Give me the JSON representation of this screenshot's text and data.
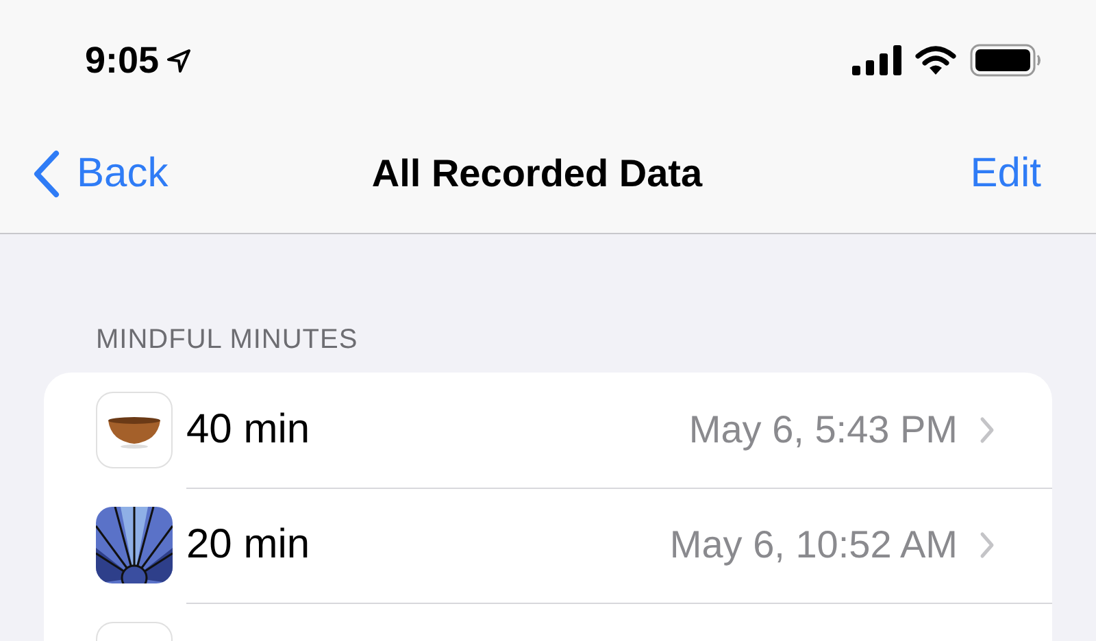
{
  "status_bar": {
    "time": "9:05",
    "location_active": true
  },
  "nav": {
    "back": "Back",
    "title": "All Recorded Data",
    "action": "Edit"
  },
  "section": {
    "header": "MINDFUL MINUTES",
    "rows": [
      {
        "kind": "bowl",
        "value": "40 min",
        "date": "May 6, 5:43 PM"
      },
      {
        "kind": "rays",
        "value": "20 min",
        "date": "May 6, 10:52 AM"
      },
      {
        "kind": "blank"
      }
    ]
  }
}
